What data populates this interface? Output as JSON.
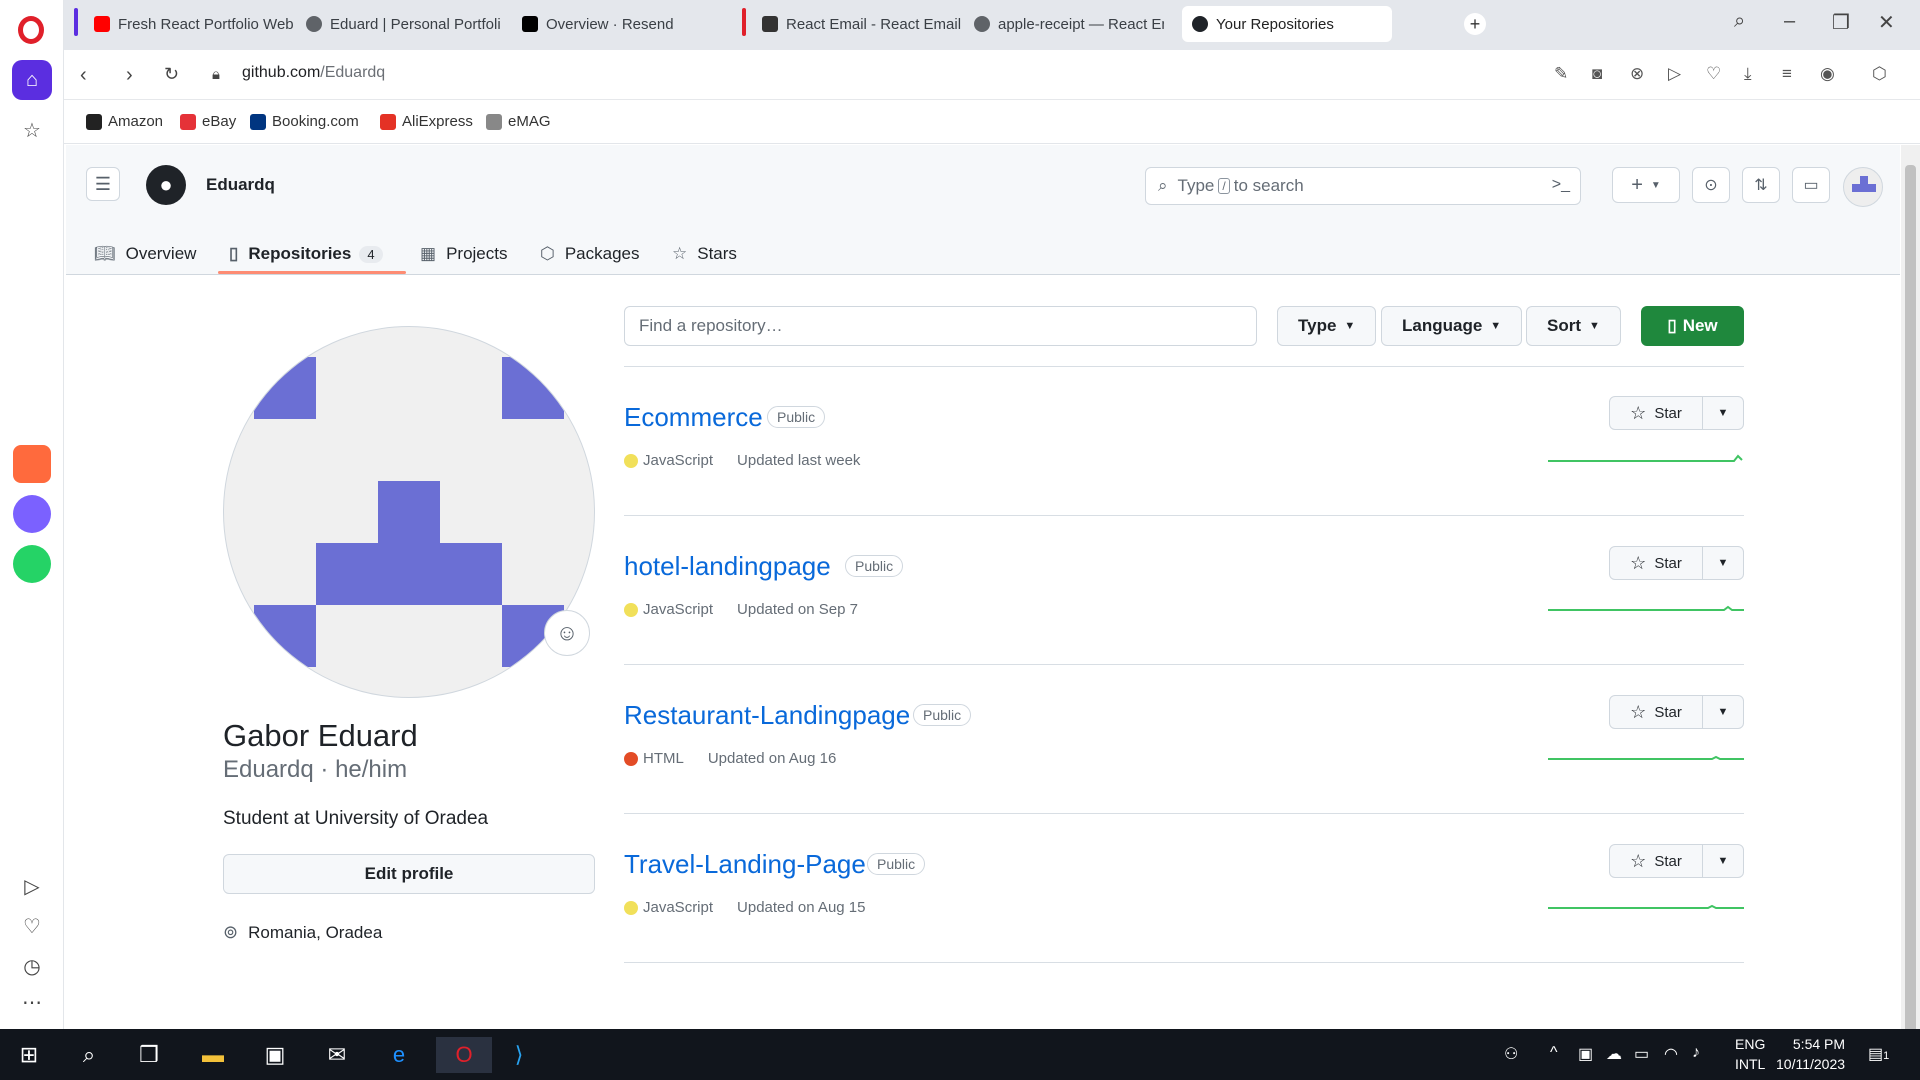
{
  "browser": {
    "tabs": [
      {
        "label": "Fresh React Portfolio Web",
        "color": "#ff0000"
      },
      {
        "label": "Eduard | Personal Portfolio",
        "color": "#5f6368"
      },
      {
        "label": "Overview · Resend",
        "color": "#000000"
      },
      {
        "label": "React Email - React Email",
        "color": "#333333"
      },
      {
        "label": "apple-receipt — React Em",
        "color": "#5f6368"
      },
      {
        "label": "Your Repositories",
        "color": "#1f2328"
      }
    ],
    "new_tab": "+",
    "url_host": "github.com",
    "url_path": "/Eduardq",
    "bookmarks": [
      {
        "label": "Amazon",
        "color": "#222222"
      },
      {
        "label": "eBay",
        "color": "#e53238"
      },
      {
        "label": "Booking.com",
        "color": "#003580"
      },
      {
        "label": "AliExpress",
        "color": "#e43225"
      },
      {
        "label": "eMAG",
        "color": "#555555"
      }
    ]
  },
  "header": {
    "username": "Eduardq",
    "search_pre": "Type",
    "search_key": "/",
    "search_post": "to search",
    "plus": "+"
  },
  "nav_tabs": [
    {
      "label": "Overview",
      "icon": "book-icon"
    },
    {
      "label": "Repositories",
      "icon": "repo-icon",
      "count": "4"
    },
    {
      "label": "Projects",
      "icon": "table-icon"
    },
    {
      "label": "Packages",
      "icon": "package-icon"
    },
    {
      "label": "Stars",
      "icon": "star-icon"
    }
  ],
  "profile": {
    "name": "Gabor Eduard",
    "login_line": "Eduardq · he/him",
    "bio": "Student at University of Oradea",
    "edit_button": "Edit profile",
    "location": "Romania, Oradea",
    "avatar_color": "#6b6fd4"
  },
  "filters": {
    "find_placeholder": "Find a repository…",
    "type": "Type",
    "language": "Language",
    "sort": "Sort",
    "new": "New"
  },
  "repos": [
    {
      "name": "Ecommerce",
      "visibility": "Public",
      "language": "JavaScript",
      "lang_color": "#f1e05a",
      "updated": "Updated last week",
      "star": "Star"
    },
    {
      "name": "hotel-landingpage",
      "visibility": "Public",
      "language": "JavaScript",
      "lang_color": "#f1e05a",
      "updated": "Updated on Sep 7",
      "star": "Star"
    },
    {
      "name": "Restaurant-Landingpage",
      "visibility": "Public",
      "language": "HTML",
      "lang_color": "#e34c26",
      "updated": "Updated on Aug 16",
      "star": "Star"
    },
    {
      "name": "Travel-Landing-Page",
      "visibility": "Public",
      "language": "JavaScript",
      "lang_color": "#f1e05a",
      "updated": "Updated on Aug 15",
      "star": "Star"
    }
  ],
  "taskbar": {
    "lang_1": "ENG",
    "lang_2": "INTL",
    "time": "5:54 PM",
    "date": "10/11/2023",
    "notifications": "1"
  },
  "colors": {
    "accent_green": "#1f883d",
    "link_blue": "#0969da",
    "tab_underline": "#fd8c73",
    "opera_red": "#e0202a",
    "opera_purple": "#5b2ee0"
  }
}
